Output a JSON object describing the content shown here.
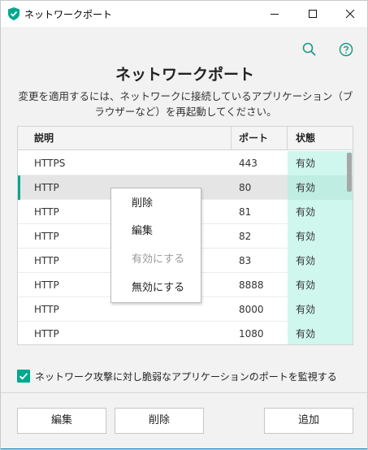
{
  "window": {
    "title": "ネットワークポート"
  },
  "header": {
    "title": "ネットワークポート",
    "subtitle": "変更を適用するには、ネットワークに接続しているアプリケーション（ブラウザーなど）を再起動してください。"
  },
  "table": {
    "columns": [
      "説明",
      "ポート",
      "状態"
    ],
    "rows": [
      {
        "desc": "HTTPS",
        "port": "443",
        "status": "有効",
        "selected": false
      },
      {
        "desc": "HTTP",
        "port": "80",
        "status": "有効",
        "selected": true
      },
      {
        "desc": "HTTP",
        "port": "81",
        "status": "有効",
        "selected": false
      },
      {
        "desc": "HTTP",
        "port": "82",
        "status": "有効",
        "selected": false
      },
      {
        "desc": "HTTP",
        "port": "83",
        "status": "有効",
        "selected": false
      },
      {
        "desc": "HTTP",
        "port": "8888",
        "status": "有効",
        "selected": false
      },
      {
        "desc": "HTTP",
        "port": "8000",
        "status": "有効",
        "selected": false
      },
      {
        "desc": "HTTP",
        "port": "1080",
        "status": "有効",
        "selected": false
      }
    ]
  },
  "context_menu": {
    "items": [
      {
        "label": "削除",
        "disabled": false
      },
      {
        "label": "編集",
        "disabled": false
      },
      {
        "label": "有効にする",
        "disabled": true
      },
      {
        "label": "無効にする",
        "disabled": false
      }
    ]
  },
  "options": {
    "monitor_checkbox_label": "ネットワーク攻撃に対し脆弱なアプリケーションのポートを監視する",
    "monitor_checked": true
  },
  "buttons": {
    "edit": "編集",
    "delete": "削除",
    "add": "追加"
  },
  "icons": {
    "app": "kaspersky-shield-icon",
    "search": "search-icon",
    "help": "help-icon"
  },
  "colors": {
    "accent": "#00a88e",
    "status_bg": "#cff7ee",
    "selected_row": "#e5e5e5"
  }
}
